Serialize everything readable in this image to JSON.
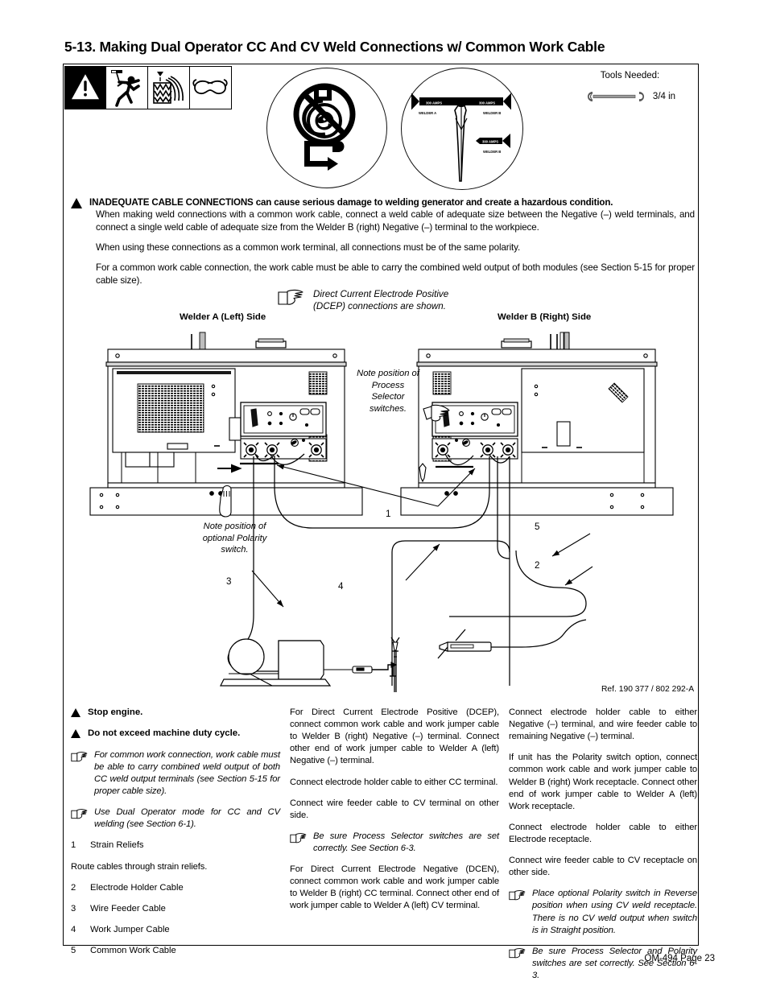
{
  "document": {
    "section_number": "5-13.",
    "section_title": "5-13.  Making Dual Operator CC And CV Weld Connections w/ Common Work Cable",
    "reference": "Ref. 190 377 / 802 292-A",
    "footer": "OM-494 Page 23"
  },
  "tools": {
    "label": "Tools Needed:",
    "wrench_size": "3/4 in"
  },
  "safety_icons": [
    "warning-triangle-icon",
    "electric-shock-icon",
    "hot-sparks-icon",
    "eye-protection-icon"
  ],
  "circle_graphics": [
    "no-arc-welding-near-engine-icon",
    "dual-operator-amps-icon"
  ],
  "amps_icon_labels": {
    "left_arrow": "300 AMPS",
    "right_arrow": "300 AMPS",
    "left_caption": "WELDER A",
    "right_caption": "WELDER B",
    "lower_arrow": "300 AMPS",
    "lower_caption": "WELDER B"
  },
  "warning": {
    "headline": "INADEQUATE CABLE CONNECTIONS can cause serious damage to welding generator and create a hazardous condition.",
    "paragraphs": [
      "When making weld connections with a common work cable, connect a weld cable of adequate size between the Negative (–) weld terminals, and connect a single weld cable of adequate size from the Welder B (right) Negative (–) terminal to the workpiece.",
      "When using these connections as a common work terminal, all connections must be of the same polarity.",
      "For a common work cable connection, the work cable must be able to carry the combined weld output of both modules (see Section 5-15 for proper cable size)."
    ]
  },
  "diagram": {
    "dcep_note": "Direct Current Electrode Positive (DCEP) connections are shown.",
    "welder_a_label": "Welder A (Left) Side",
    "welder_b_label": "Welder B (Right) Side",
    "note_process": "Note position of Process Selector switches.",
    "note_polarity": "Note position of optional Polarity switch.",
    "callouts": [
      {
        "num": "1",
        "name": "strain-reliefs"
      },
      {
        "num": "2",
        "name": "electrode-holder-cable"
      },
      {
        "num": "3",
        "name": "wire-feeder-cable"
      },
      {
        "num": "4",
        "name": "work-jumper-cable"
      },
      {
        "num": "5",
        "name": "common-work-cable"
      }
    ]
  },
  "column_left": {
    "warnings": [
      "Stop engine.",
      "Do not exceed machine duty cycle."
    ],
    "notes": [
      "For common work connection, work cable must be able to carry combined weld output of both CC weld output terminals (see Section 5-15 for proper cable size).",
      "Use Dual Operator mode for CC and CV welding (see Section 6-1)."
    ],
    "item1_num": "1",
    "item1_label": "Strain Reliefs",
    "route_text": "Route cables through strain reliefs.",
    "items": [
      {
        "num": "2",
        "label": "Electrode Holder Cable"
      },
      {
        "num": "3",
        "label": "Wire Feeder Cable"
      },
      {
        "num": "4",
        "label": "Work Jumper Cable"
      },
      {
        "num": "5",
        "label": "Common Work Cable"
      }
    ]
  },
  "column_middle": {
    "p1": "For Direct Current Electrode Positive (DCEP), connect common work cable and work jumper cable to Welder B (right) Negative (–) terminal. Connect other end of work jumper cable to Welder A (left) Negative (–) terminal.",
    "p2": "Connect electrode holder cable to either CC terminal.",
    "p3": "Connect wire feeder cable to CV terminal on other side.",
    "note1": "Be sure Process Selector switches are set correctly. See Section 6-3.",
    "p4": "For Direct Current Electrode Negative (DCEN), connect common work cable and work jumper cable to Welder B (right) CC terminal. Connect other end of work jumper cable to Welder A (left) CV terminal."
  },
  "column_right": {
    "p1": "Connect electrode holder cable to either Negative (–) terminal, and wire feeder cable to remaining Negative (–) terminal.",
    "p2": "If unit has the Polarity switch option, connect common work cable and work jumper cable to Welder B (right) Work receptacle. Connect other end of work jumper cable to Welder A (left) Work receptacle.",
    "p3": "Connect electrode holder cable to either Electrode receptacle.",
    "p4": "Connect wire feeder cable to CV receptacle on other side.",
    "note1": "Place optional Polarity switch in Reverse position when using CV weld receptacle. There is no CV weld output when switch is in Straight position.",
    "note2": "Be sure Process Selector and Polarity switches are set correctly. See Section 6-3."
  }
}
